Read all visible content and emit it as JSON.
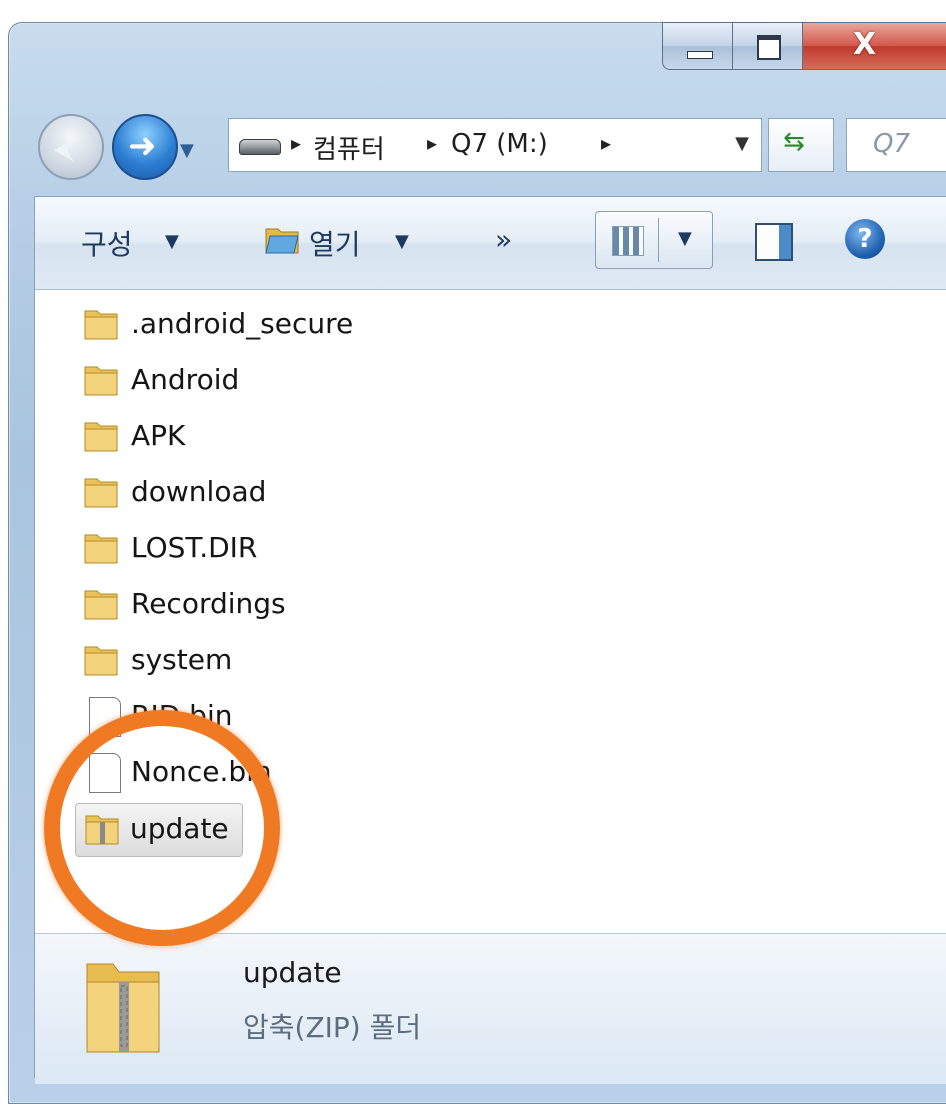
{
  "window": {
    "minimize_icon": "minimize-icon",
    "maximize_icon": "maximize-icon",
    "close_icon": "close-icon"
  },
  "navbar": {
    "breadcrumb": [
      "컴퓨터",
      "Q7 (M:)"
    ],
    "search_placeholder": "Q7"
  },
  "toolbar": {
    "organize_label": "구성",
    "open_label": "열기",
    "more_label": "»"
  },
  "files": [
    {
      "name": ".android_secure",
      "type": "folder"
    },
    {
      "name": "Android",
      "type": "folder"
    },
    {
      "name": "APK",
      "type": "folder"
    },
    {
      "name": "download",
      "type": "folder"
    },
    {
      "name": "LOST.DIR",
      "type": "folder"
    },
    {
      "name": "Recordings",
      "type": "folder"
    },
    {
      "name": "system",
      "type": "folder"
    },
    {
      "name": "RID.bin",
      "type": "file"
    },
    {
      "name": "Nonce.bin",
      "type": "file"
    },
    {
      "name": "update",
      "type": "zip",
      "selected": true
    }
  ],
  "status": {
    "name": "update",
    "type": "압축(ZIP) 폴더"
  },
  "colors": {
    "highlight_ring": "#f07a24",
    "folder": "#e9c25a",
    "title_bar": "#b6cee6"
  }
}
